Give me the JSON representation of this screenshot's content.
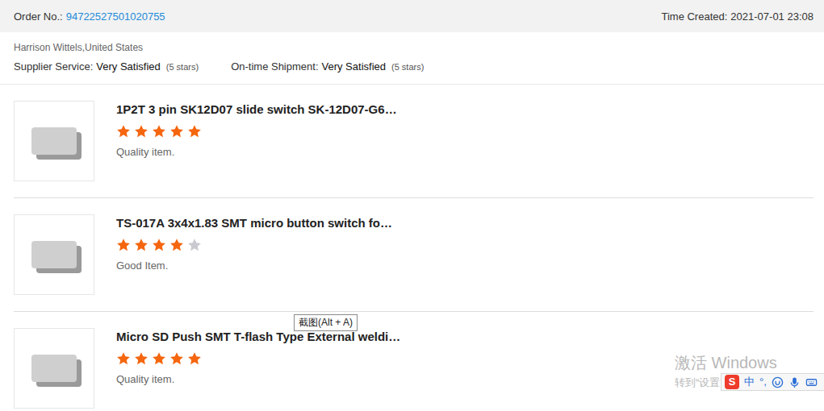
{
  "header": {
    "order_label": "Order No.:",
    "order_number": "94722527501020755",
    "time_label": "Time Created:",
    "time": "2021-07-01 23:08"
  },
  "buyer": "Harrison Wittels,United States",
  "ratings": [
    {
      "label": "Supplier Service:",
      "value": "Very Satisfied",
      "note": "(5 stars)"
    },
    {
      "label": "On-time Shipment:",
      "value": "Very Satisfied",
      "note": "(5 stars)"
    }
  ],
  "items": [
    {
      "title": "1P2T 3 pin SK12D07 slide switch SK-12D07-G6…",
      "stars": 5,
      "comment": "Quality item."
    },
    {
      "title": "TS-017A 3x4x1.83 SMT micro button switch fo…",
      "stars": 4,
      "comment": "Good Item."
    },
    {
      "title": "Micro SD Push SMT T-flash Type External weldi…",
      "stars": 5,
      "comment": "Quality item."
    }
  ],
  "tooltip": "截图(Alt + A)",
  "watermark": {
    "title": "激活 Windows",
    "subtitle": "转到“设置”"
  },
  "ime_bar": {
    "logo": "S",
    "items": [
      "中",
      "°,"
    ]
  }
}
